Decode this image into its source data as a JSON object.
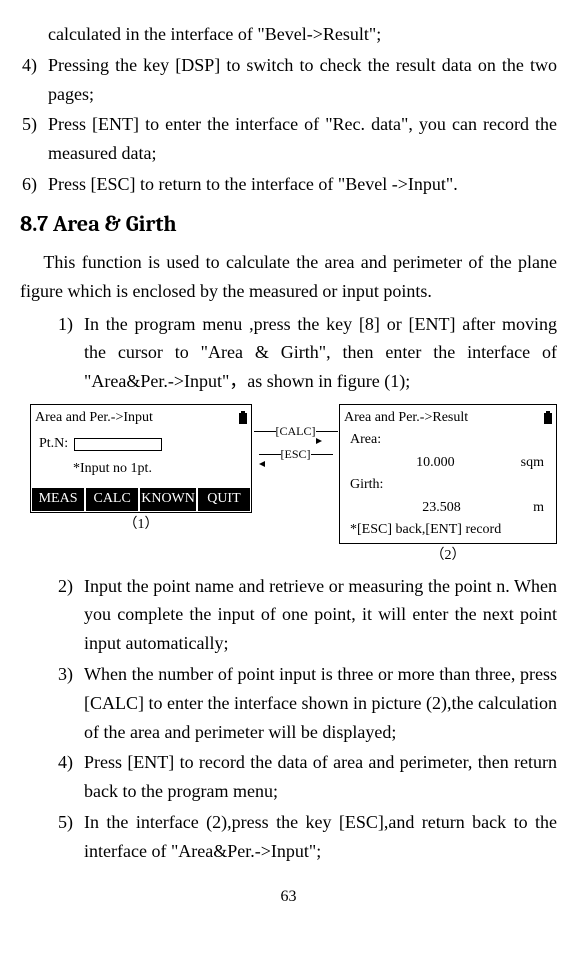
{
  "top": {
    "pre": "calculated in the interface of \"Bevel->Result\";",
    "s4n": "4)",
    "s4": "Pressing the key [DSP] to switch to check the result data on the two pages;",
    "s5n": "5)",
    "s5": "Press [ENT] to enter the interface of \"Rec. data\", you can record the measured data;",
    "s6n": "6)",
    "s6": "Press [ESC] to return to the interface of \"Bevel ->Input\"."
  },
  "h2": "8.7 Area & Girth",
  "intro": "This function is used to calculate the area and perimeter of the plane figure which is enclosed by the measured or input points.",
  "sub": {
    "s1n": "1)",
    "s1": "In the program menu ,press the key [8] or [ENT] after moving the cursor to \"Area & Girth\", then enter the interface of \"Area&Per.->Input\"，as shown in figure (1);",
    "s2n": "2)",
    "s2": "Input the point name and retrieve or measuring the point n. When you complete the input of one point, it will enter the next point input automatically;",
    "s3n": "3)",
    "s3": "When the number of point input is three or more than three, press [CALC] to enter the interface shown in picture (2),the calculation of the area and perimeter will be displayed;",
    "s4n": "4)",
    "s4": "Press [ENT] to record the data of area and perimeter, then return back to the program menu;",
    "s5n": "5)",
    "s5": "In the interface (2),press the key [ESC],and return back to the interface of \"Area&Per.->Input\";"
  },
  "diag": {
    "left": {
      "title": "Area and Per.->Input",
      "ptn": "Pt.N:",
      "hint": "*Input no 1pt.",
      "b1": "MEAS",
      "b2": "CALC",
      "b3": "KNOWN",
      "b4": "QUIT",
      "cap": "（1）"
    },
    "mid": {
      "calc": "[CALC]",
      "esc": "[ESC]"
    },
    "right": {
      "title": "Area and Per.->Result",
      "areaL": "Area:",
      "areaV": "10.000",
      "areaU": "sqm",
      "girthL": "Girth:",
      "girthV": "23.508",
      "girthU": "m",
      "foot": "*[ESC] back,[ENT] record",
      "cap": "（2）"
    }
  },
  "page": "63"
}
